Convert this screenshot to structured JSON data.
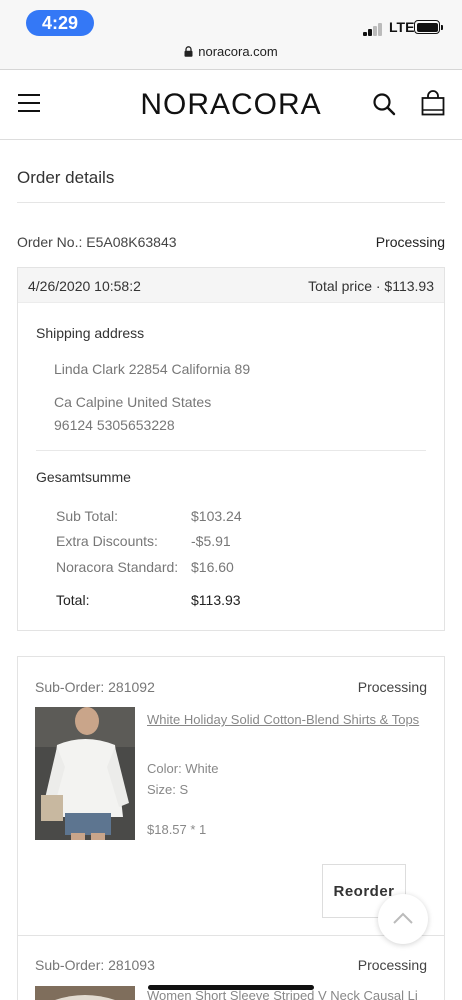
{
  "status_bar": {
    "time": "4:29",
    "network": "LTE"
  },
  "browser": {
    "url": "noracora.com"
  },
  "header": {
    "logo": "NORACORA"
  },
  "page": {
    "title": "Order details"
  },
  "order": {
    "number_label": "Order No.: E5A08K63843",
    "status": "Processing",
    "date": "4/26/2020 10:58:2",
    "total_price": "Total price · $113.93",
    "shipping": {
      "title": "Shipping address",
      "line1": "Linda Clark 22854 California 89",
      "line2": "Ca Calpine United States",
      "line3": "96124 5305653228"
    },
    "summary": {
      "title": "Gesamtsumme",
      "rows": [
        {
          "label": "Sub Total:",
          "value": "$103.24"
        },
        {
          "label": "Extra Discounts:",
          "value": "-$5.91"
        },
        {
          "label": "Noracora Standard:",
          "value": "$16.60"
        }
      ],
      "total": {
        "label": "Total:",
        "value": "$113.93"
      }
    }
  },
  "sub_orders": [
    {
      "id": "Sub-Order: 281092",
      "status": "Processing",
      "product": "White Holiday Solid Cotton-Blend Shirts & Tops",
      "color": "Color: White",
      "size": "Size: S",
      "price": "$18.57 * 1",
      "button": "Reorder"
    },
    {
      "id": "Sub-Order: 281093",
      "status": "Processing",
      "product": "Women Short Sleeve Striped V Neck Causal Li"
    }
  ],
  "colors": {
    "accent": "#3478f6",
    "text": "#333333",
    "muted": "#888888",
    "border": "#e3e3e3"
  }
}
